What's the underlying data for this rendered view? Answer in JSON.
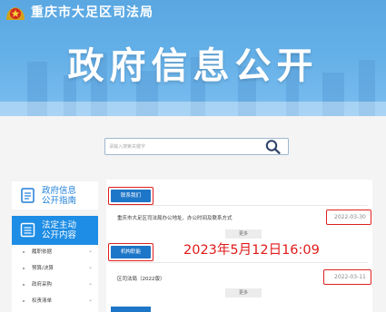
{
  "header": {
    "site_name": "重庆市大足区司法局",
    "title": "政府信息公开"
  },
  "search": {
    "placeholder": "请输入搜索关键字",
    "icon": "search-icon"
  },
  "sidebar": {
    "cards": [
      {
        "label_line1": "政府信息",
        "label_line2": "公开指南",
        "icon": "document-icon"
      },
      {
        "label_line1": "法定主动",
        "label_line2": "公开内容",
        "icon": "list-icon"
      }
    ],
    "items": [
      {
        "label": "履职依据",
        "icon": "chevron-down-icon"
      },
      {
        "label": "预算/决算",
        "icon": "chevron-down-icon"
      },
      {
        "label": "政府采购",
        "icon": "chevron-down-icon"
      },
      {
        "label": "权责清单",
        "icon": "chevron-down-icon"
      }
    ]
  },
  "content": {
    "sections": [
      {
        "heading": "联系我们",
        "item_text": "重庆市大足区司法局办公地址、办公时间及联系方式",
        "item_date": "2022-03-30",
        "more_label": "更多"
      },
      {
        "heading": "机构职能",
        "item_text": "区司法局（2022版）",
        "item_date": "2022-03-11",
        "more_label": "更多"
      }
    ]
  },
  "overlay": {
    "timestamp": "2023年5月12日16:09"
  },
  "colors": {
    "banner": "#63afe7",
    "primary": "#1e76c8",
    "highlight": "#e02020"
  }
}
